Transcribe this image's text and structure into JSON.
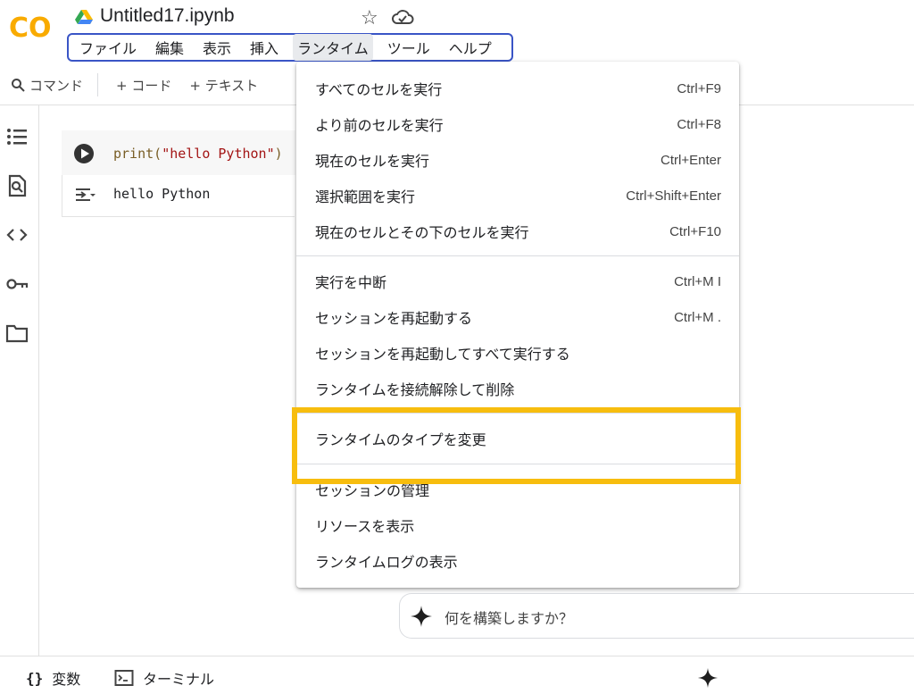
{
  "app": {
    "logo_text": "CO",
    "notebook_title": "Untitled17.ipynb"
  },
  "menubar": [
    "ファイル",
    "編集",
    "表示",
    "挿入",
    "ランタイム",
    "ツール",
    "ヘルプ"
  ],
  "active_menu_index": 4,
  "toolbar": {
    "command": "コマンド",
    "add_code": "+ コード",
    "add_text": "+ テキスト"
  },
  "cell": {
    "code_prefix": "print(",
    "code_string": "\"hello Python\"",
    "code_suffix": ")",
    "output": "hello Python"
  },
  "runtime_menu": {
    "group1": [
      {
        "label": "すべてのセルを実行",
        "shortcut": "Ctrl+F9"
      },
      {
        "label": "より前のセルを実行",
        "shortcut": "Ctrl+F8"
      },
      {
        "label": "現在のセルを実行",
        "shortcut": "Ctrl+Enter"
      },
      {
        "label": "選択範囲を実行",
        "shortcut": "Ctrl+Shift+Enter"
      },
      {
        "label": "現在のセルとその下のセルを実行",
        "shortcut": "Ctrl+F10"
      }
    ],
    "group2": [
      {
        "label": "実行を中断",
        "shortcut": "Ctrl+M I"
      },
      {
        "label": "セッションを再起動する",
        "shortcut": "Ctrl+M ."
      },
      {
        "label": "セッションを再起動してすべて実行する",
        "shortcut": ""
      },
      {
        "label": "ランタイムを接続解除して削除",
        "shortcut": ""
      }
    ],
    "group3": [
      {
        "label": "ランタイムのタイプを変更",
        "shortcut": ""
      }
    ],
    "group4": [
      {
        "label": "セッションの管理",
        "shortcut": ""
      },
      {
        "label": "リソースを表示",
        "shortcut": ""
      },
      {
        "label": "ランタイムログの表示",
        "shortcut": ""
      }
    ]
  },
  "prompt": {
    "placeholder": "何を構築しますか？"
  },
  "bottom": {
    "variables_icon": "{}",
    "variables": "変数",
    "terminal": "ターミナル"
  },
  "colors": {
    "highlight": "#f7bd0e",
    "menubar_outline": "#3a55c6",
    "logo_orange": "#f9ab00",
    "logo_dark_orange": "#e37400"
  }
}
